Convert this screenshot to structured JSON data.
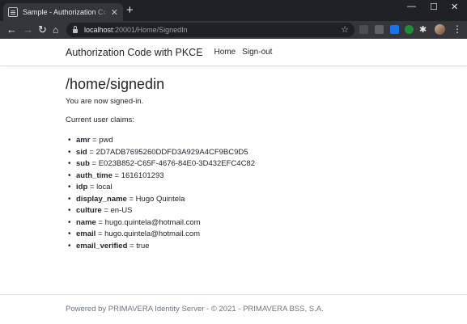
{
  "browser": {
    "tab_title": "Sample - Authorization Code with PKCE",
    "url_host": "localhost",
    "url_path": ":20001/Home/SignedIn",
    "icons": {
      "favicon": "document-icon",
      "back": "back-arrow-icon",
      "forward": "forward-arrow-icon",
      "reload": "reload-icon",
      "home": "home-icon",
      "lock": "lock-icon",
      "star": "star-icon",
      "extensions": "puzzle-icon",
      "menu": "kebab-menu-icon"
    }
  },
  "navbar": {
    "brand": "Authorization Code with PKCE",
    "links": [
      "Home",
      "Sign-out"
    ]
  },
  "main": {
    "title": "/home/signedin",
    "signed_in_text": "You are now signed-in.",
    "claims_heading": "Current user claims:",
    "claims": [
      {
        "key": "amr",
        "value": " = pwd"
      },
      {
        "key": "sid",
        "value": " = 2D7ADB7695260DDFD3A929A4CF9BC9D5"
      },
      {
        "key": "sub",
        "value": " = E023B852-C65F-4676-84E0-3D432EFC4C82"
      },
      {
        "key": "auth_time",
        "value": " = 1616101293"
      },
      {
        "key": "idp",
        "value": " = local"
      },
      {
        "key": "display_name",
        "value": " = Hugo Quintela"
      },
      {
        "key": "culture",
        "value": " = en-US"
      },
      {
        "key": "name",
        "value": " = hugo.quintela@hotmail.com"
      },
      {
        "key": "email",
        "value": " = hugo.quintela@hotmail.com"
      },
      {
        "key": "email_verified",
        "value": " = true"
      }
    ]
  },
  "footer": {
    "text": "Powered by PRIMAVERA Identity Server - © 2021 - PRIMAVERA BSS, S.A."
  },
  "colors": {
    "text": "#212529",
    "muted": "#6c757d",
    "chrome_dark": "#202124",
    "chrome_toolbar": "#35363a"
  }
}
